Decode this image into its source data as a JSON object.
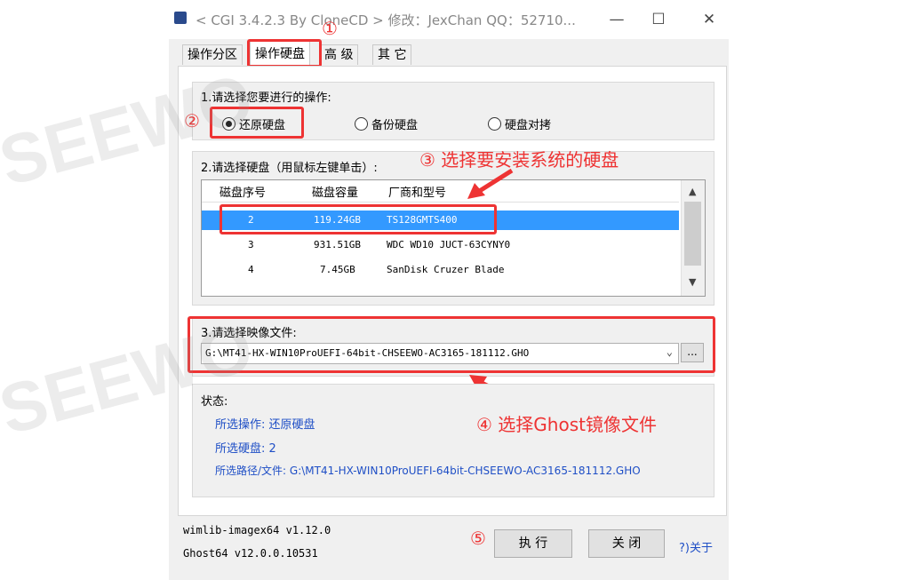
{
  "window": {
    "title": "< CGI 3.4.2.3 By CloneCD > 修改：JexChan  QQ：52710...",
    "minimize": "—",
    "maximize": "☐",
    "close": "✕"
  },
  "tabs": [
    {
      "label": "操作分区"
    },
    {
      "label": "操作硬盘"
    },
    {
      "label": "高 级"
    },
    {
      "label": "其 它"
    }
  ],
  "section1": {
    "title": "1.请选择您要进行的操作:",
    "options": [
      {
        "label": "还原硬盘",
        "selected": true
      },
      {
        "label": "备份硬盘",
        "selected": false
      },
      {
        "label": "硬盘对拷",
        "selected": false
      }
    ]
  },
  "section2": {
    "title": "2.请选择硬盘（用鼠标左键单击）:",
    "columns": [
      "磁盘序号",
      "磁盘容量",
      "厂商和型号"
    ],
    "rows": [
      {
        "index": "2",
        "capacity": "119.24GB",
        "model": "TS128GMTS400",
        "selected": true
      },
      {
        "index": "3",
        "capacity": "931.51GB",
        "model": "WDC WD10  JUCT-63CYNY0",
        "selected": false
      },
      {
        "index": "4",
        "capacity": "7.45GB",
        "model": "SanDisk  Cruzer Blade",
        "selected": false
      }
    ]
  },
  "section3": {
    "title": "3.请选择映像文件:",
    "file_path": "G:\\MT41-HX-WIN10ProUEFI-64bit-CHSEEWO-AC3165-181112.GHO",
    "browse_label": "..."
  },
  "status": {
    "title": "状态:",
    "operation_label": "所选操作: 还原硬盘",
    "disk_label": "所选硬盘:   2",
    "path_label": "所选路径/文件: G:\\MT41-HX-WIN10ProUEFI-64bit-CHSEEWO-AC3165-181112.GHO"
  },
  "footer": {
    "wimlib_version": "wimlib-imagex64 v1.12.0",
    "ghost_version": "Ghost64 v12.0.0.10531",
    "execute_label": "执 行",
    "close_label": "关 闭",
    "about_label": "?)关于"
  },
  "annotations": {
    "step1": "①",
    "step2": "②",
    "step3": "③  选择要安装系统的硬盘",
    "step4": "④ 选择Ghost镜像文件",
    "step5": "⑤"
  },
  "watermark": {
    "text": "SEEWO"
  },
  "colors": {
    "highlight_red": "#ee3333",
    "selection_blue": "#3399ff",
    "status_blue": "#1f4fc6"
  }
}
